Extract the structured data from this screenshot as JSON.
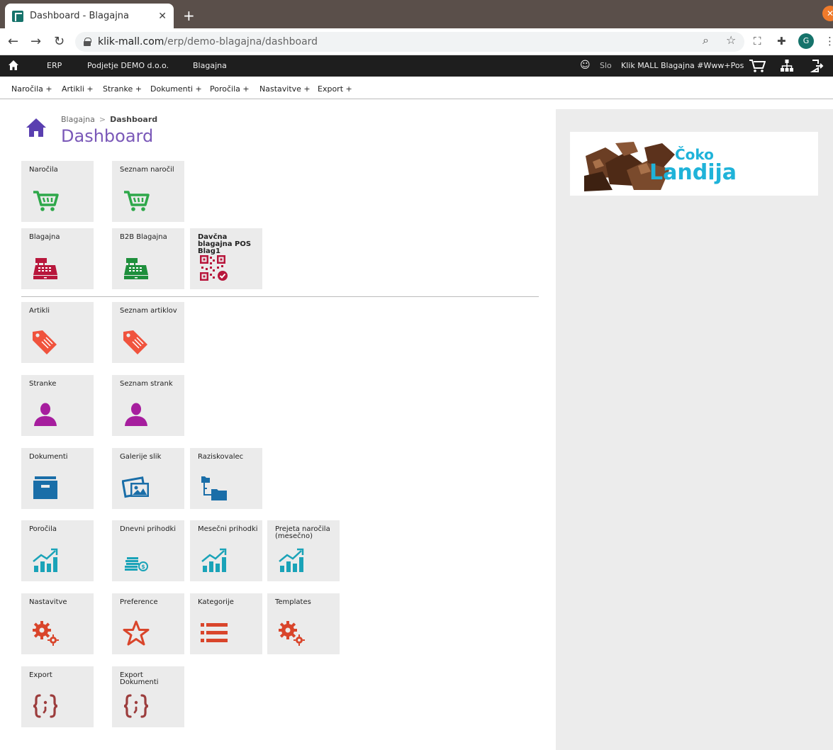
{
  "browser": {
    "tab_title": "Dashboard - Blagajna",
    "url_host": "klik-mall.com",
    "url_path": "/erp/demo-blagajna/dashboard"
  },
  "topbar": {
    "erp": "ERP",
    "company": "Podjetje DEMO d.o.o.",
    "module": "Blagajna",
    "lang": "Slo",
    "store": "Klik MALL Blagajna #Www+Pos"
  },
  "menu": {
    "items": [
      "Naročila +",
      "Artikli +",
      "Stranke +",
      "Dokumenti +",
      "Poročila +",
      "Nastavitve +",
      "Export +"
    ]
  },
  "page": {
    "breadcrumb_parent": "Blagajna",
    "breadcrumb_current": "Dashboard",
    "title": "Dashboard"
  },
  "banner": {
    "brand_top": "Čoko",
    "brand_bottom": "Landija"
  },
  "tiles": [
    {
      "label": "Naročila",
      "icon": "cart-icon",
      "color": "#2ea84a"
    },
    {
      "label": "Seznam naročil",
      "icon": "cart-icon",
      "color": "#2ea84a"
    },
    {
      "label": "Blagajna",
      "icon": "cash-register-icon",
      "color": "#b8173c"
    },
    {
      "label": "B2B Blagajna",
      "icon": "cash-register-icon",
      "color": "#1e8f3c"
    },
    {
      "label": "Davčna blagajna POS Blag1",
      "icon": "qr-code-icon",
      "color": "#b8173c"
    },
    {
      "label": "Artikli",
      "icon": "tag-icon",
      "color": "#f0533d"
    },
    {
      "label": "Seznam artiklov",
      "icon": "tag-icon",
      "color": "#f0533d"
    },
    {
      "label": "Stranke",
      "icon": "user-icon",
      "color": "#a61e9e"
    },
    {
      "label": "Seznam strank",
      "icon": "user-icon",
      "color": "#a61e9e"
    },
    {
      "label": "Dokumenti",
      "icon": "archive-box-icon",
      "color": "#1a6ea8"
    },
    {
      "label": "Galerije slik",
      "icon": "image-gallery-icon",
      "color": "#1a6ea8"
    },
    {
      "label": "Raziskovalec",
      "icon": "folder-tree-icon",
      "color": "#1a6ea8"
    },
    {
      "label": "Poročila",
      "icon": "chart-up-icon",
      "color": "#1aa3b8"
    },
    {
      "label": "Dnevni prihodki",
      "icon": "coins-icon",
      "color": "#1aa3b8"
    },
    {
      "label": "Mesečni prihodki",
      "icon": "chart-up-icon",
      "color": "#1aa3b8"
    },
    {
      "label": "Prejeta naročila (mesečno)",
      "icon": "chart-up-icon",
      "color": "#1aa3b8"
    },
    {
      "label": "Nastavitve",
      "icon": "gears-icon",
      "color": "#d9452b"
    },
    {
      "label": "Preference",
      "icon": "star-icon",
      "color": "#d9452b"
    },
    {
      "label": "Kategorije",
      "icon": "list-icon",
      "color": "#d9452b"
    },
    {
      "label": "Templates",
      "icon": "gears-icon",
      "color": "#d9452b"
    },
    {
      "label": "Export",
      "icon": "code-braces-icon",
      "color": "#9c3d3d"
    },
    {
      "label": "Export Dokumenti",
      "icon": "code-braces-icon",
      "color": "#9c3d3d"
    }
  ]
}
